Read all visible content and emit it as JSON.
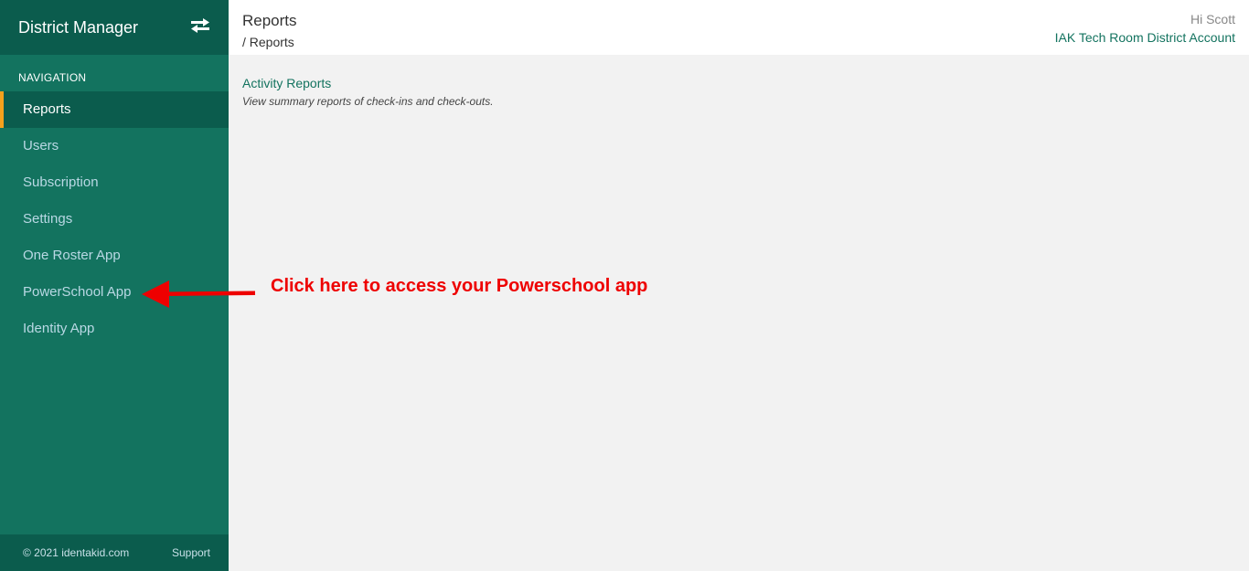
{
  "sidebar": {
    "brand_title": "District Manager",
    "swap_icon": "swap-arrows-icon",
    "nav_header": "NAVIGATION",
    "items": [
      {
        "label": "Reports",
        "active": true
      },
      {
        "label": "Users",
        "active": false
      },
      {
        "label": "Subscription",
        "active": false
      },
      {
        "label": "Settings",
        "active": false
      },
      {
        "label": "One Roster App",
        "active": false
      },
      {
        "label": "PowerSchool App",
        "active": false
      },
      {
        "label": "Identity App",
        "active": false
      }
    ],
    "footer": {
      "copyright": "© 2021 identakid.com",
      "support": "Support"
    }
  },
  "header": {
    "title": "Reports",
    "breadcrumb": "/ Reports",
    "greeting": "Hi Scott",
    "account": "IAK Tech Room District Account"
  },
  "main": {
    "reports": [
      {
        "title": "Activity Reports",
        "description": "View summary reports of check-ins and check-outs."
      }
    ]
  },
  "annotation": {
    "text": "Click here to access your Powerschool app",
    "color": "#ee0000"
  },
  "colors": {
    "brand_dark": "#0b5c4d",
    "brand": "#13735f",
    "active_indicator": "#f4a11d"
  }
}
